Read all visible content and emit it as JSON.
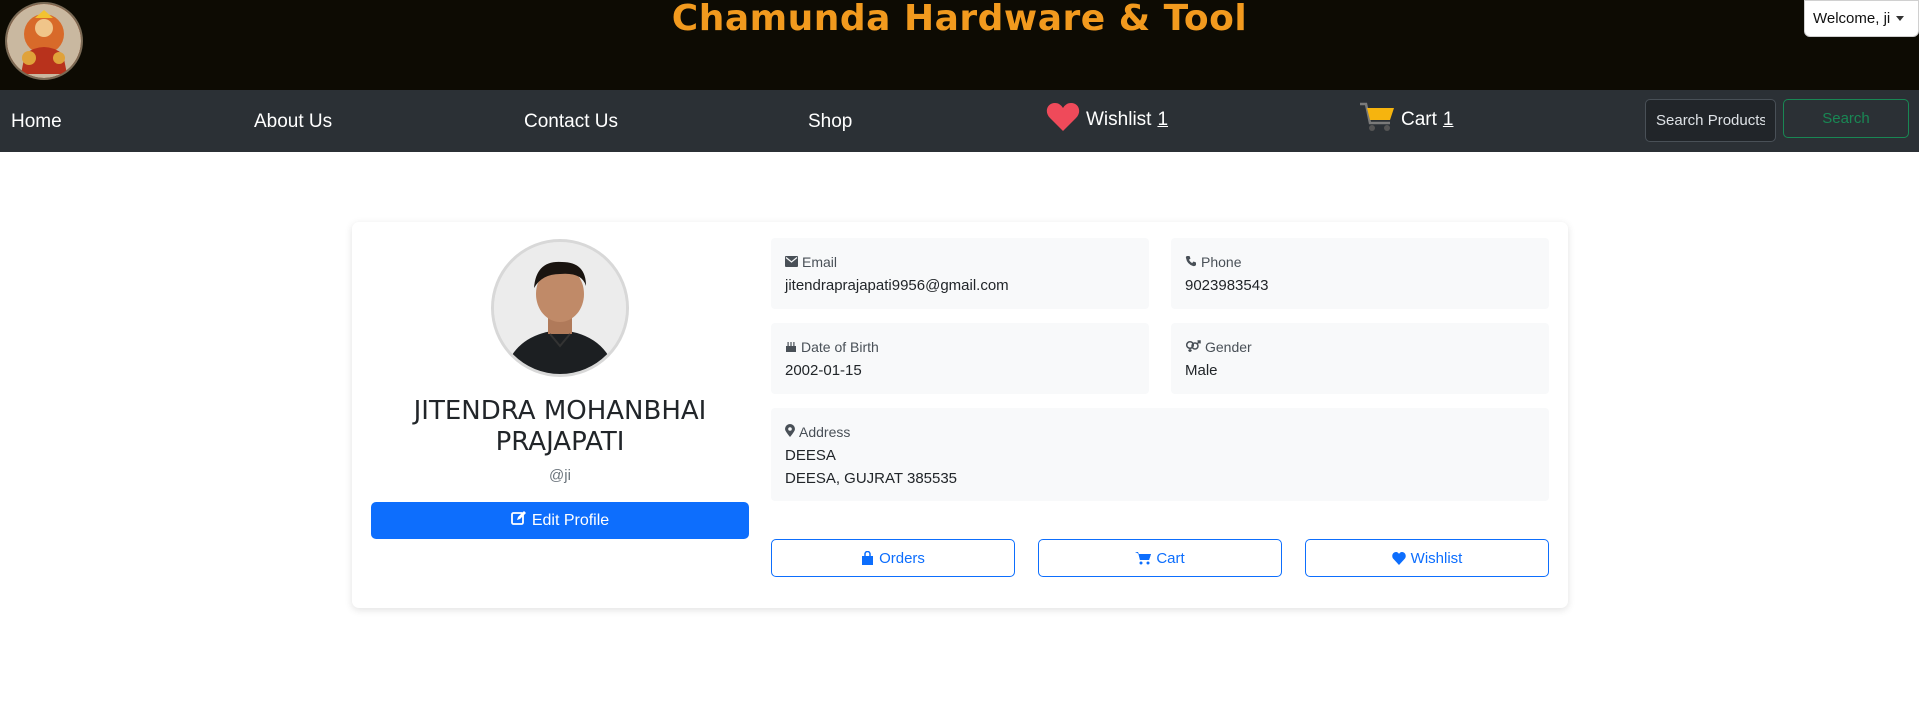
{
  "header": {
    "site_title": "Chamunda Hardware & Tool",
    "welcome_label": "Welcome, ji"
  },
  "nav": {
    "home": "Home",
    "about": "About Us",
    "contact": "Contact Us",
    "shop": "Shop",
    "wishlist_label": "Wishlist",
    "wishlist_count": "1",
    "cart_label": "Cart",
    "cart_count": "1",
    "search_placeholder": "Search Products",
    "search_button": "Search"
  },
  "profile": {
    "full_name": "JITENDRA MOHANBHAI PRAJAPATI",
    "username": "@ji",
    "edit_label": "Edit Profile",
    "email_label": "Email",
    "email": "jitendraprajapati9956@gmail.com",
    "phone_label": "Phone",
    "phone": "9023983543",
    "dob_label": "Date of Birth",
    "dob": "2002-01-15",
    "gender_label": "Gender",
    "gender": "Male",
    "address_label": "Address",
    "address_line1": "DEESA",
    "address_line2": "DEESA, GUJRAT 385535"
  },
  "actions": {
    "orders": "Orders",
    "cart": "Cart",
    "wishlist": "Wishlist"
  },
  "colors": {
    "brand_orange": "#f29a1e",
    "primary_blue": "#0d6efd",
    "success_green": "#198754",
    "heart_red": "#ef4a5a",
    "cart_yellow": "#f6b40e"
  },
  "icons": [
    "logo",
    "heart-icon",
    "cart-icon",
    "envelope-icon",
    "phone-icon",
    "birthday-cake-icon",
    "gender-icon",
    "map-marker-icon",
    "edit-icon",
    "shopping-bag-icon",
    "shopping-cart-icon"
  ]
}
